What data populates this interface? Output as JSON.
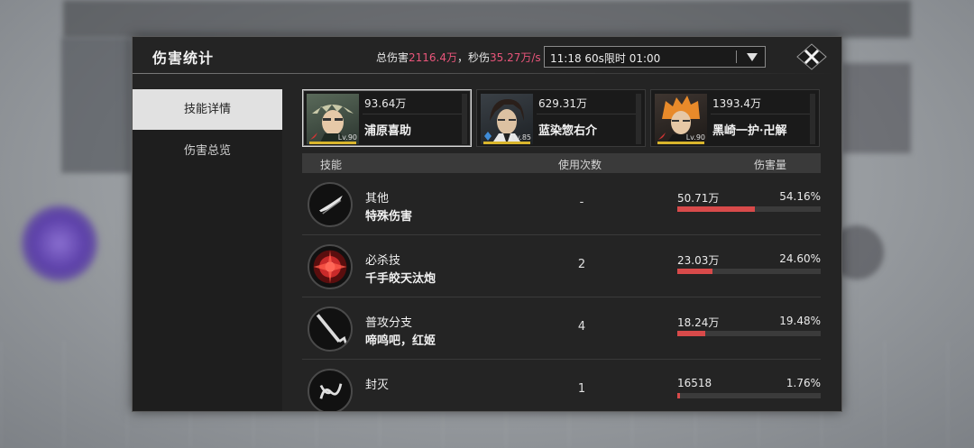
{
  "panel": {
    "title": "伤害统计",
    "summary": {
      "total_label": "总伤害",
      "total_value": "2116.4万",
      "dps_label": "，秒伤",
      "dps_value": "35.27万/s"
    },
    "time_filter": "11:18 60s限时 01:00"
  },
  "tabs": [
    {
      "label": "技能详情",
      "active": true
    },
    {
      "label": "伤害总览",
      "active": false
    }
  ],
  "characters": [
    {
      "damage": "93.64万",
      "name": "浦原喜助",
      "level": "Lv.90",
      "selected": true,
      "icon": "character-urahara-portrait"
    },
    {
      "damage": "629.31万",
      "name": "蓝染惣右介",
      "level": "Lv.85",
      "selected": false,
      "icon": "character-aizen-portrait"
    },
    {
      "damage": "1393.4万",
      "name": "黑崎一护·卍解",
      "level": "Lv.90",
      "selected": false,
      "icon": "character-ichigo-portrait"
    }
  ],
  "table": {
    "headers": {
      "skill": "技能",
      "uses": "使用次数",
      "damage": "伤害量"
    },
    "rows": [
      {
        "category": "其他",
        "name": "特殊伤害",
        "uses": "-",
        "damage": "50.71万",
        "percent": "54.16%",
        "fraction": 0.5416,
        "icon": "slash-skill-icon"
      },
      {
        "category": "必杀技",
        "name": "千手皎天汰炮",
        "uses": "2",
        "damage": "23.03万",
        "percent": "24.60%",
        "fraction": 0.246,
        "icon": "red-burst-skill-icon"
      },
      {
        "category": "普攻分支",
        "name": "啼鸣吧，红姬",
        "uses": "4",
        "damage": "18.24万",
        "percent": "19.48%",
        "fraction": 0.1948,
        "icon": "cane-sword-skill-icon"
      },
      {
        "category": "封灭",
        "name": "",
        "uses": "1",
        "damage": "16518",
        "percent": "1.76%",
        "fraction": 0.0176,
        "icon": "seal-skill-icon"
      }
    ]
  },
  "colors": {
    "accent_pink": "#e8557a",
    "bar_red": "#d84a4a",
    "level_gold": "#d9b52c"
  }
}
